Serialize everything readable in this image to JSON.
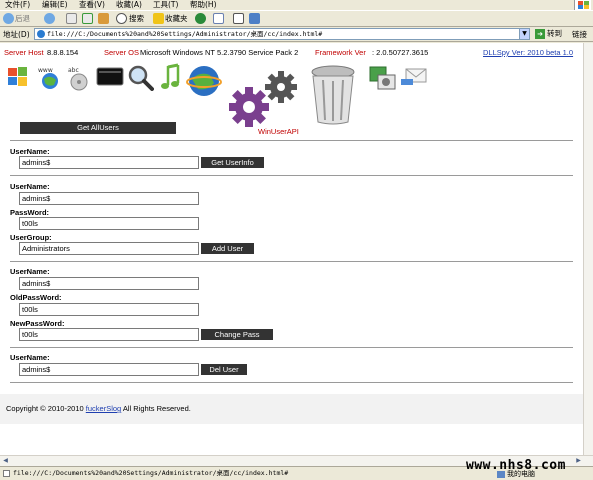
{
  "browser": {
    "menu": [
      "文件(F)",
      "编辑(E)",
      "查看(V)",
      "收藏(A)",
      "工具(T)",
      "帮助(H)"
    ],
    "toolbar": {
      "back": "后退",
      "search": "搜索",
      "favorites": "收藏夹"
    },
    "address": {
      "label": "地址(D)",
      "url": "file:///C:/Documents%20and%20Settings/Administrator/桌面/cc/index.html#",
      "go": "转到",
      "links": "链接"
    },
    "status": {
      "text": "file:///C:/Documents%20and%20Settings/Administrator/桌面/cc/index.html#",
      "zone": "我的电脑",
      "watermark": "www.nhs8.com"
    }
  },
  "page": {
    "server_host_label": "Server Host",
    "server_host": "8.8.8.154",
    "server_os_label": "Server OS",
    "server_os": "Microsoft Windows NT 5.2.3790 Service Pack 2",
    "framework_label": "Framework Ver",
    "framework": ": 2.0.50727.3615",
    "version_link": "DLLSpy Ver: 2010 beta 1.0",
    "api_label": "WinUserAPI",
    "get_all_users": "Get AllUsers",
    "section_info": {
      "username_label": "UserName:",
      "username": "admins$",
      "button": "Get UserInfo"
    },
    "section_add": {
      "username_label": "UserName:",
      "username": "admins$",
      "password_label": "PassWord:",
      "password": "t00ls",
      "group_label": "UserGroup:",
      "group": "Administrators",
      "button": "Add User"
    },
    "section_change": {
      "username_label": "UserName:",
      "username": "admins$",
      "oldpass_label": "OldPassWord:",
      "oldpass": "t00ls",
      "newpass_label": "NewPassWord:",
      "newpass": "t00ls",
      "button": "Change Pass"
    },
    "section_del": {
      "username_label": "UserName:",
      "username": "admins$",
      "button": "Del User"
    },
    "footer": {
      "prefix": "Copyright © 2010-2010",
      "link": "fuckerSlog",
      "suffix": "All Rights Reserved."
    }
  }
}
